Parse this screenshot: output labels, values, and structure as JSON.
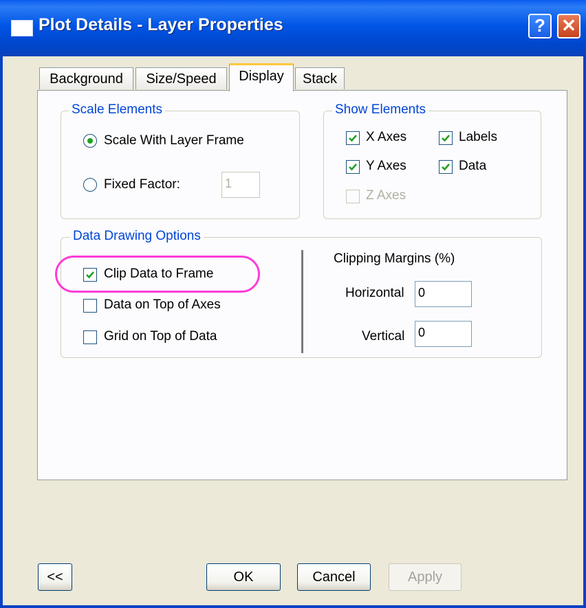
{
  "window": {
    "title": "Plot Details - Layer Properties",
    "help_glyph": "?",
    "close_glyph": "✕"
  },
  "tabs": [
    {
      "label": "Background"
    },
    {
      "label": "Size/Speed"
    },
    {
      "label": "Display",
      "active": true
    },
    {
      "label": "Stack"
    }
  ],
  "scale_elements": {
    "title": "Scale Elements",
    "options": [
      {
        "label": "Scale With Layer Frame",
        "selected": true
      },
      {
        "label": "Fixed Factor:",
        "selected": false
      }
    ],
    "fixed_factor_value": "1"
  },
  "show_elements": {
    "title": "Show Elements",
    "items": [
      {
        "label": "X Axes",
        "checked": true
      },
      {
        "label": "Labels",
        "checked": true
      },
      {
        "label": "Y Axes",
        "checked": true
      },
      {
        "label": "Data",
        "checked": true
      },
      {
        "label": "Z Axes",
        "checked": false,
        "disabled": true
      }
    ]
  },
  "data_drawing": {
    "title": "Data Drawing Options",
    "options": [
      {
        "label": "Clip Data to Frame",
        "checked": true
      },
      {
        "label": "Data on Top of Axes",
        "checked": false
      },
      {
        "label": "Grid on Top of Data",
        "checked": false
      }
    ],
    "clipping_title": "Clipping Margins (%)",
    "horizontal_label": "Horizontal",
    "horizontal_value": "0",
    "vertical_label": "Vertical",
    "vertical_value": "0"
  },
  "buttons": {
    "collapse": "<<",
    "ok": "OK",
    "cancel": "Cancel",
    "apply": "Apply"
  },
  "colors": {
    "titlebar": "#0055e5",
    "group_label": "#0046d5",
    "check_mark": "#21a121",
    "highlight_ring": "#ff3bd8"
  }
}
